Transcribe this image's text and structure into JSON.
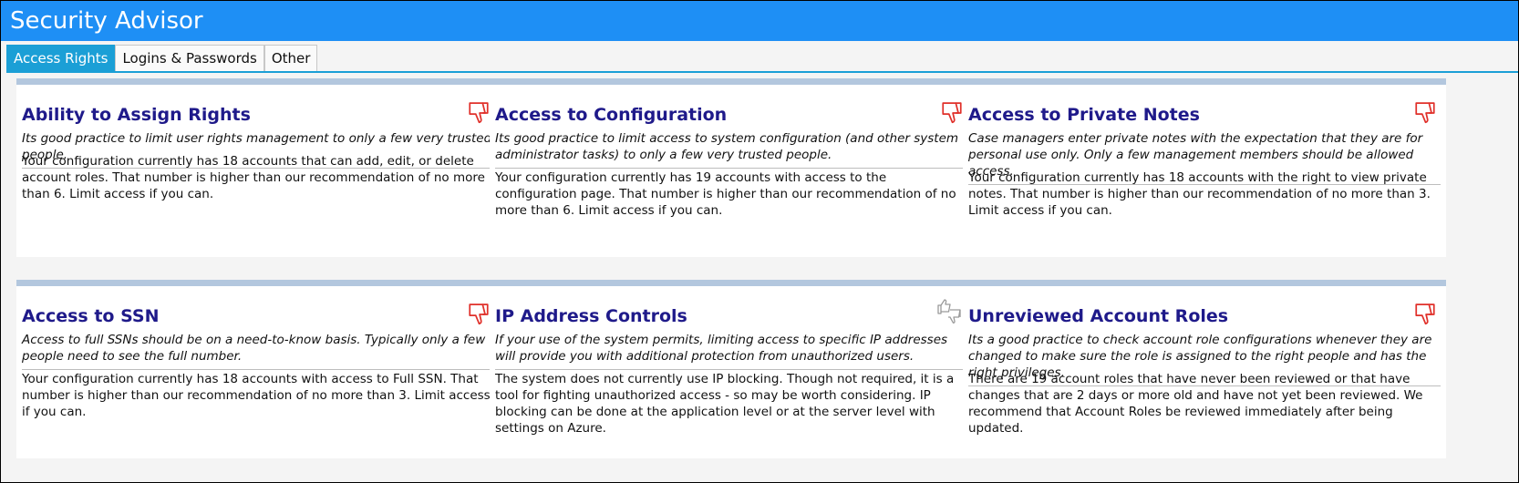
{
  "window": {
    "title": "Security Advisor"
  },
  "tabs": [
    {
      "label": "Access Rights",
      "active": true
    },
    {
      "label": "Logins & Passwords",
      "active": false
    },
    {
      "label": "Other",
      "active": false
    }
  ],
  "colors": {
    "titlebar": "#1e8ff5",
    "active_tab": "#1b9fd6",
    "card_title": "#1f1a8a",
    "thumbs_down": "#e0302a",
    "neutral_icon": "#9a9a9a"
  },
  "cards": [
    {
      "title": "Ability to Assign Rights",
      "status_icon": "thumbs-down-icon",
      "description": "Its good practice to limit user rights management to only a few very trusted people.",
      "body": "Your configuration currently has 18 accounts that can add, edit, or delete account roles. That number is higher than our recommendation of no more than 6. Limit access if you can."
    },
    {
      "title": "Access to Configuration",
      "status_icon": "thumbs-down-icon",
      "description": "Its good practice to limit access to system configuration (and other system administrator tasks) to only a few very trusted people.",
      "body": "Your configuration currently has 19 accounts with access to the configuration page. That number is higher than our recommendation of no more than 6. Limit access if you can."
    },
    {
      "title": "Access to Private Notes",
      "status_icon": "thumbs-down-icon",
      "description": "Case managers enter private notes with the expectation that they are for personal use only. Only a few management members should be allowed access.",
      "body": "Your configuration currently has 18 accounts with the right to view private notes. That number is higher than our recommendation of no more than 3. Limit access if you can."
    },
    {
      "title": "Access to SSN",
      "status_icon": "thumbs-down-icon",
      "description": "Access to full SSNs should be on a need-to-know basis. Typically only a few people need to see the full number.",
      "body": "Your configuration currently has 18 accounts with access to Full SSN. That number is higher than our recommendation of no more than 3. Limit access if you can."
    },
    {
      "title": "IP Address Controls",
      "status_icon": "thumbs-up-down-icon",
      "description": "If your use of the system permits, limiting access to specific IP addresses will provide you with additional protection from unauthorized users.",
      "body": "The system does not currently use IP blocking. Though not required, it is a tool for fighting unauthorized access - so may be worth considering. IP blocking can be done at the application level or at the server level with settings on Azure."
    },
    {
      "title": "Unreviewed Account Roles",
      "status_icon": "thumbs-down-icon",
      "description": "Its a good practice to check account role configurations whenever they are changed to make sure the role is assigned to the right people and has the right privileges.",
      "body": "There are 19 account roles that have never been reviewed or that have changes that are 2 days or more old and have not yet been reviewed. We recommend that Account Roles be reviewed immediately after being updated."
    }
  ]
}
